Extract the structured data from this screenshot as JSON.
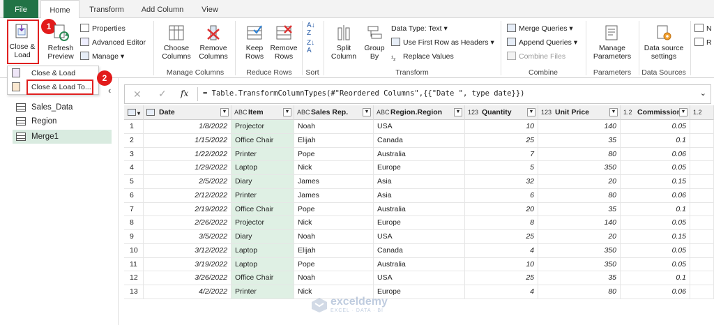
{
  "tabs": [
    "File",
    "Home",
    "Transform",
    "Add Column",
    "View"
  ],
  "ribbon": {
    "close_load": "Close &\nLoad",
    "refresh_preview": "Refresh\nPreview",
    "properties": "Properties",
    "advanced_editor": "Advanced Editor",
    "manage": "Manage",
    "choose_columns": "Choose\nColumns",
    "remove_columns": "Remove\nColumns",
    "group_manage_columns": "Manage Columns",
    "keep_rows": "Keep\nRows",
    "remove_rows": "Remove\nRows",
    "group_reduce_rows": "Reduce Rows",
    "group_sort": "Sort",
    "split_column": "Split\nColumn",
    "group_by": "Group\nBy",
    "data_type": "Data Type: Text",
    "use_first_row": "Use First Row as Headers",
    "replace_values": "Replace Values",
    "group_transform": "Transform",
    "merge_queries": "Merge Queries",
    "append_queries": "Append Queries",
    "combine_files": "Combine Files",
    "group_combine": "Combine",
    "manage_parameters": "Manage\nParameters",
    "group_parameters": "Parameters",
    "data_source_settings": "Data source\nsettings",
    "group_data_sources": "Data Sources",
    "cut_1": "N",
    "cut_2": "R"
  },
  "menu": {
    "close_load": "Close & Load",
    "close_load_to": "Close & Load To..."
  },
  "badges": {
    "one": "1",
    "two": "2"
  },
  "queries": [
    "Sales_Data",
    "Region",
    "Merge1"
  ],
  "formula": "= Table.TransformColumnTypes(#\"Reordered Columns\",{{\"Date \", type date}})",
  "formula_fx": "fx",
  "columns": [
    {
      "type": "",
      "name": "Date"
    },
    {
      "type": "ABC",
      "name": "Item"
    },
    {
      "type": "ABC",
      "name": "Sales Rep."
    },
    {
      "type": "ABC",
      "name": "Region.Region"
    },
    {
      "type": "123",
      "name": "Quantity"
    },
    {
      "type": "123",
      "name": "Unit Price"
    },
    {
      "type": "1.2",
      "name": "Commission"
    },
    {
      "type": "1.2",
      "name": ""
    }
  ],
  "rows": [
    [
      "1",
      "1/8/2022",
      "Projector",
      "Noah",
      "USA",
      "10",
      "140",
      "0.05"
    ],
    [
      "2",
      "1/15/2022",
      "Office Chair",
      "Elijah",
      "Canada",
      "25",
      "35",
      "0.1"
    ],
    [
      "3",
      "1/22/2022",
      "Printer",
      "Pope",
      "Australia",
      "7",
      "80",
      "0.06"
    ],
    [
      "4",
      "1/29/2022",
      "Laptop",
      "Nick",
      "Europe",
      "5",
      "350",
      "0.05"
    ],
    [
      "5",
      "2/5/2022",
      "Diary",
      "James",
      "Asia",
      "32",
      "20",
      "0.15"
    ],
    [
      "6",
      "2/12/2022",
      "Printer",
      "James",
      "Asia",
      "6",
      "80",
      "0.06"
    ],
    [
      "7",
      "2/19/2022",
      "Office Chair",
      "Pope",
      "Australia",
      "20",
      "35",
      "0.1"
    ],
    [
      "8",
      "2/26/2022",
      "Projector",
      "Nick",
      "Europe",
      "8",
      "140",
      "0.05"
    ],
    [
      "9",
      "3/5/2022",
      "Diary",
      "Noah",
      "USA",
      "25",
      "20",
      "0.15"
    ],
    [
      "10",
      "3/12/2022",
      "Laptop",
      "Elijah",
      "Canada",
      "4",
      "350",
      "0.05"
    ],
    [
      "11",
      "3/19/2022",
      "Laptop",
      "Pope",
      "Australia",
      "10",
      "350",
      "0.05"
    ],
    [
      "12",
      "3/26/2022",
      "Office Chair",
      "Noah",
      "USA",
      "25",
      "35",
      "0.1"
    ],
    [
      "13",
      "4/2/2022",
      "Printer",
      "Nick",
      "Europe",
      "4",
      "80",
      "0.06"
    ]
  ],
  "watermark": {
    "name": "exceldemy",
    "tag": "EXCEL · DATA · BI"
  },
  "colors": {
    "accent": "#217346",
    "highlight": "#e02020",
    "selected_query": "#d9ebe0"
  }
}
